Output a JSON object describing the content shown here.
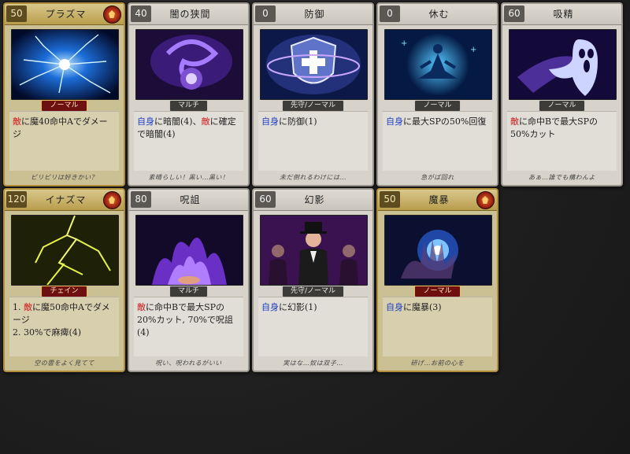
{
  "cards": [
    {
      "cost": "50",
      "name": "プラズマ",
      "type": "ノーマル",
      "desc": [
        [
          "foe",
          "敵"
        ],
        [
          "",
          "に魔40命中Aでダメージ"
        ]
      ],
      "flavor": "ビリビリは好きかい？",
      "gold": true,
      "emblem": true,
      "tag_red": true
    },
    {
      "cost": "40",
      "name": "闇の狭間",
      "type": "マルチ",
      "desc": [
        [
          "self",
          "自身"
        ],
        [
          "",
          "に暗闇(4)、"
        ],
        [
          "foe",
          "敵"
        ],
        [
          "",
          "に確定で暗闇(4)"
        ]
      ],
      "flavor": "素晴らしい！黒い…黒い！"
    },
    {
      "cost": "0",
      "name": "防御",
      "type": "先守/ノーマル",
      "desc": [
        [
          "self",
          "自身"
        ],
        [
          "",
          "に防御(1)"
        ]
      ],
      "flavor": "未だ倒れるわけには…"
    },
    {
      "cost": "0",
      "name": "休む",
      "type": "ノーマル",
      "desc": [
        [
          "self",
          "自身"
        ],
        [
          "",
          "に最大SPの50%回復"
        ]
      ],
      "flavor": "急がば回れ"
    },
    {
      "cost": "60",
      "name": "吸精",
      "type": "ノーマル",
      "desc": [
        [
          "foe",
          "敵"
        ],
        [
          "",
          "に命中Bで最大SPの50%カット"
        ]
      ],
      "flavor": "あぁ…誰でも構わんよ"
    },
    {
      "cost": "120",
      "name": "イナズマ",
      "type": "チェイン",
      "desc": [
        [
          "",
          "1. "
        ],
        [
          "foe",
          "敵"
        ],
        [
          "",
          "に魔50命中Aでダメージ\n2. 30%で麻痺(4)"
        ]
      ],
      "flavor": "空の雲をよく見てて",
      "gold": true,
      "emblem": true,
      "tag_red": true
    },
    {
      "cost": "80",
      "name": "呪詛",
      "type": "マルチ",
      "desc": [
        [
          "foe",
          "敵"
        ],
        [
          "",
          "に命中Bで最大SPの20%カット, 70%で呪詛(4)"
        ]
      ],
      "flavor": "呪い、呪われるがいい"
    },
    {
      "cost": "60",
      "name": "幻影",
      "type": "先守/ノーマル",
      "desc": [
        [
          "self",
          "自身"
        ],
        [
          "",
          "に幻影(1)"
        ]
      ],
      "flavor": "実はな…奴は双子…"
    },
    {
      "cost": "50",
      "name": "魔暴",
      "type": "ノーマル",
      "desc": [
        [
          "self",
          "自身"
        ],
        [
          "",
          "に魔暴(3)"
        ]
      ],
      "flavor": "研げ…お前の心を",
      "gold": true,
      "emblem": true,
      "tag_red": true
    }
  ],
  "art": [
    "plasma-lightning",
    "dark-swirl",
    "shield-cross",
    "meditation",
    "ghost",
    "yellow-lightning",
    "purple-flames",
    "phantom-figures",
    "blue-hand-orb"
  ],
  "colors": {
    "foe": "#d21c1c",
    "self": "#1f3fc4"
  }
}
